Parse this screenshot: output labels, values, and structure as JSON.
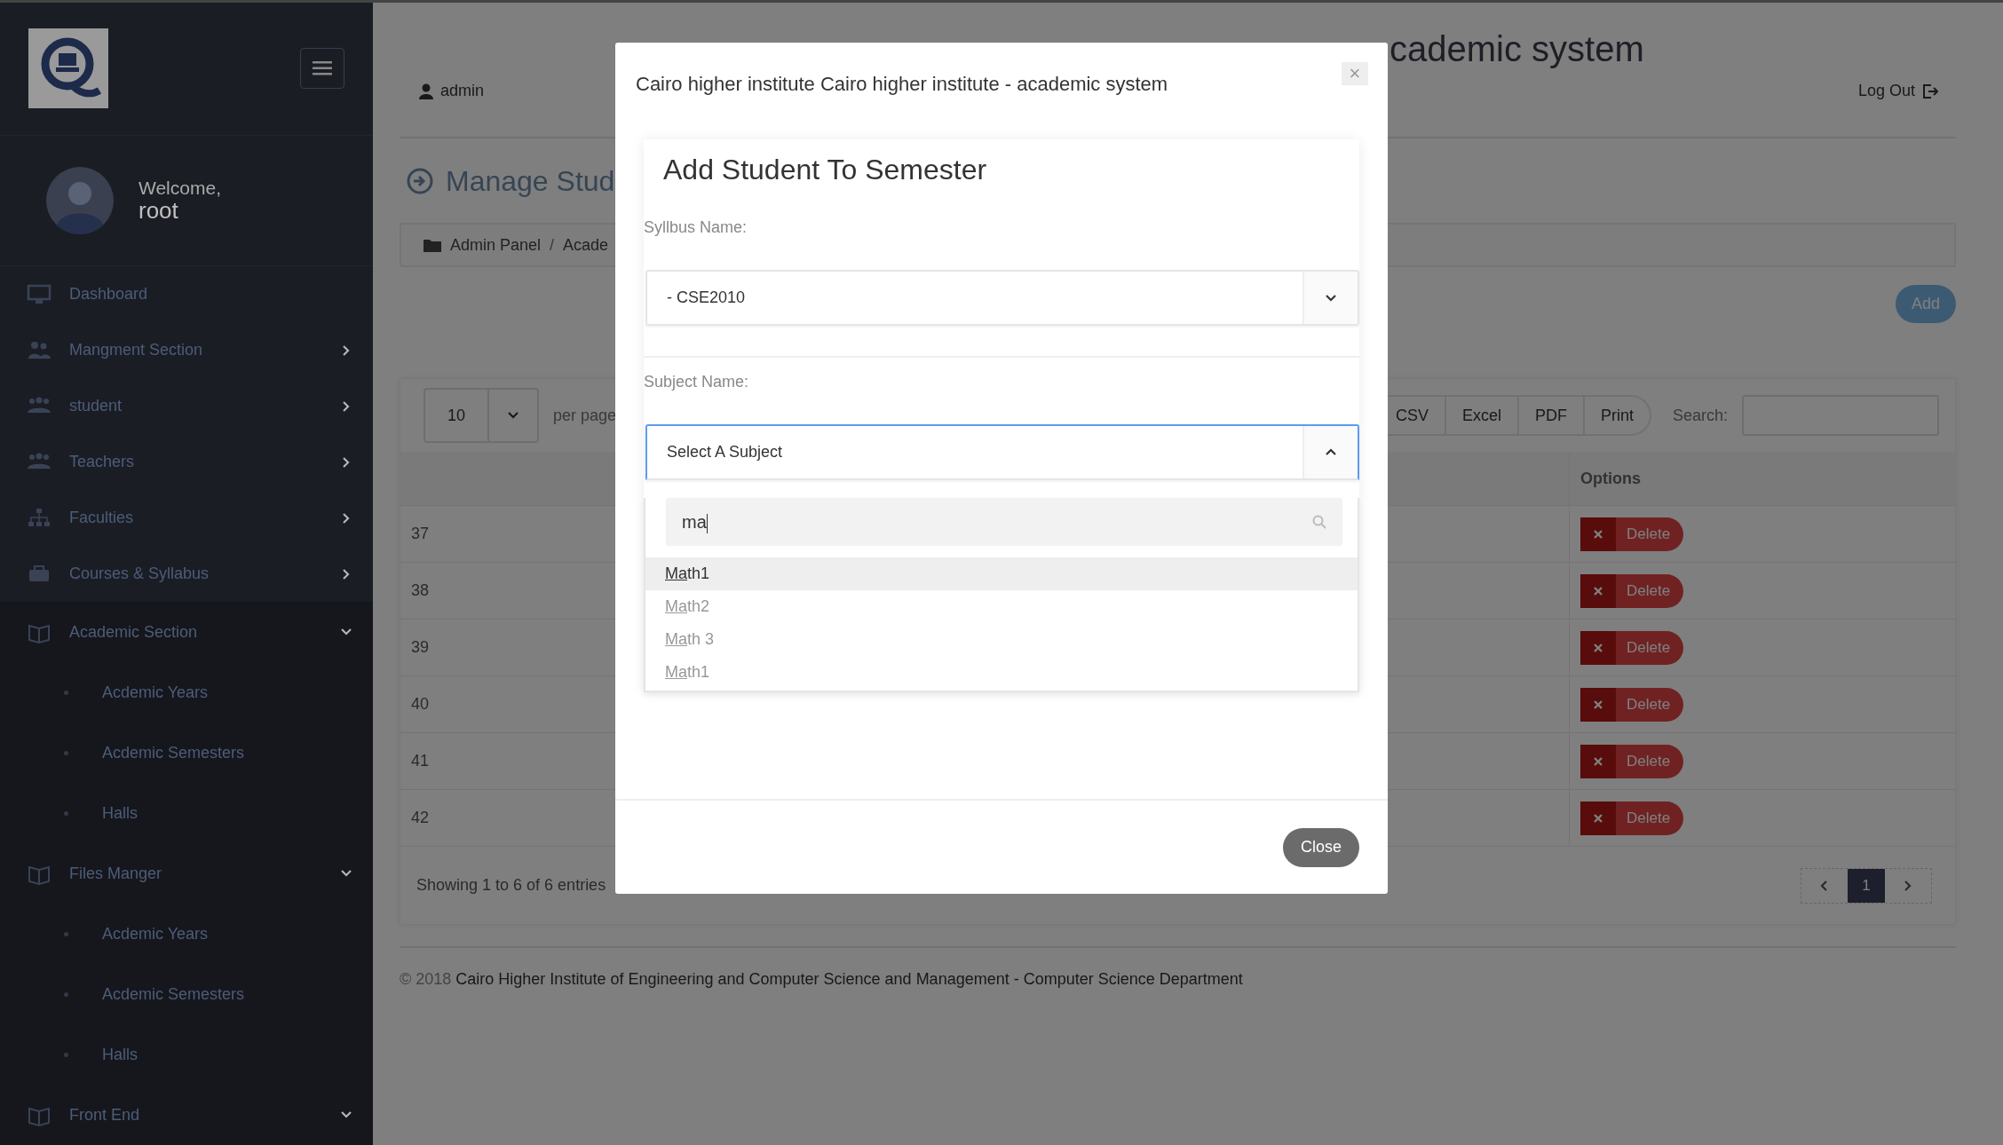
{
  "sidebar": {
    "welcome": "Welcome,",
    "user": "root",
    "items": [
      {
        "label": "Dashboard",
        "kind": "link"
      },
      {
        "label": "Mangment Section",
        "kind": "group",
        "expanded": false
      },
      {
        "label": "student",
        "kind": "group",
        "expanded": false
      },
      {
        "label": "Teachers",
        "kind": "group",
        "expanded": false
      },
      {
        "label": "Faculties",
        "kind": "group",
        "expanded": false
      },
      {
        "label": "Courses & Syllabus",
        "kind": "group",
        "expanded": false
      },
      {
        "label": "Academic Section",
        "kind": "group",
        "expanded": true,
        "children": [
          {
            "label": "Acdemic Years"
          },
          {
            "label": "Acdemic Semesters"
          },
          {
            "label": "Halls"
          }
        ]
      },
      {
        "label": "Files Manger",
        "kind": "group",
        "expanded": true,
        "children": [
          {
            "label": "Acdemic Years"
          },
          {
            "label": "Acdemic Semesters"
          },
          {
            "label": "Halls"
          }
        ]
      },
      {
        "label": "Front End",
        "kind": "group",
        "expanded": true
      }
    ]
  },
  "header": {
    "title": "cademic system",
    "user": "admin",
    "logout": "Log Out"
  },
  "page": {
    "title": "Manage Stud",
    "breadcrumb": [
      "Admin Panel",
      "Acade"
    ],
    "breadcrumb_separator": "/",
    "add_button": "Add"
  },
  "table": {
    "page_size": "10",
    "per_page": "per page",
    "export_buttons": [
      "CSV",
      "Excel",
      "PDF",
      "Print"
    ],
    "search_label": "Search:",
    "columns": [
      "Options"
    ],
    "rows": [
      {
        "column_1": "37",
        "action": "Delete"
      },
      {
        "column_1": "38",
        "action": "Delete"
      },
      {
        "column_1": "39",
        "action": "Delete"
      },
      {
        "column_1": "40",
        "action": "Delete"
      },
      {
        "column_1": "41",
        "action": "Delete"
      },
      {
        "column_1": "42",
        "action": "Delete"
      }
    ],
    "info": "Showing 1 to 6 of 6 entries",
    "pages": [
      {
        "label": "1",
        "selected": true
      }
    ]
  },
  "footer": {
    "year": "© 2018",
    "text": "Cairo Higher Institute of Engineering and Computer Science and Management - Computer Science Department"
  },
  "modal": {
    "title": "Cairo higher institute Cairo higher institute - academic system",
    "close": "×",
    "card_title": "Add Student To Semester",
    "fields": [
      {
        "label": "Syllbus Name:",
        "value": "- CSE2010",
        "expanded": false
      },
      {
        "label": "Subject Name:",
        "value": "Select A Subject",
        "expanded": true,
        "search": "ma",
        "options": [
          {
            "label": "Math1",
            "selected": true
          },
          {
            "label": "Math2",
            "selected": false
          },
          {
            "label": "Math 3",
            "selected": false
          },
          {
            "label": "Math1",
            "selected": false
          }
        ]
      }
    ],
    "close_button": "Close"
  }
}
